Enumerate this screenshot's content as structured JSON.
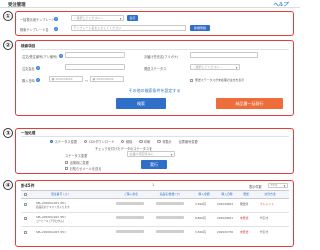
{
  "header": {
    "title": "受注管理",
    "logo": "ヘルプ"
  },
  "markers": [
    "①",
    "②",
    "③",
    "④"
  ],
  "template": {
    "label1": "一括表示用テンプレート",
    "select_value": "－選択してください－",
    "show_button": "表示",
    "label2": "検索テンプレート名",
    "input_placeholder": "テンプレート名を入力してください",
    "register_button": "新規登録"
  },
  "search": {
    "title": "検索項目",
    "f1": "注文/受注番号(アシ番号)",
    "f2": "お届け先氏名(フリガナ)",
    "f3": "注文会社",
    "f4": "発送ステータス",
    "f4_value": "－選択してください－",
    "f5": "購入日時",
    "date_from": "2020/08/02",
    "date_to": "2020/08/02",
    "tilde": "～",
    "f6": "発送ステータスが未処理の注文を表示",
    "expand_link": "その他の検索条件を設定する",
    "search_button": "検索",
    "bulk_button": "納品書一括発行"
  },
  "bulk": {
    "title": "一括処理",
    "options": [
      "ステータス変更",
      "CSVダウンロード",
      "削除",
      "印刷",
      "非表示",
      "伝票番号変更"
    ],
    "note": "チェックを付けたデータのステータスを",
    "status_label": "ステータス変更",
    "status_value": "お届け手配済みに",
    "cb1": "出荷前に変更",
    "cb2": "お知らせメールを送る",
    "execute_button": "実行"
  },
  "results": {
    "count": "計45件",
    "page": "1",
    "per_page_label": "表示件数",
    "per_page_value": "50件",
    "headers": [
      "受注番号 ({})",
      "ご購入者名",
      "商品名/数量 (ナ)",
      "購入金額",
      "購入日時",
      "発送",
      "決済方法"
    ],
    "rows": [
      {
        "id": "SPL-202004-001 (PC)",
        "sub": "商品名のテキストが入ります",
        "price": "3,300円",
        "date": "2020/08/02",
        "status": "発送済",
        "pay": "クレジット"
      },
      {
        "id": "SPL-202004-002 (PC)",
        "sub": "コーヒーA (アグロサム)",
        "price": "8,800円",
        "date": "2020/08/01",
        "status": "未発送",
        "pay": "代引き"
      },
      {
        "id": "SPL-202004-003 (PC)",
        "sub": "",
        "price": "3,300円",
        "date": "2020/07/30",
        "status": "未発送",
        "pay": "代引き"
      }
    ]
  },
  "colors": {
    "accent": "#2f6fc9",
    "marker_border": "#e53b3b",
    "orange": "#ef6d3a"
  }
}
